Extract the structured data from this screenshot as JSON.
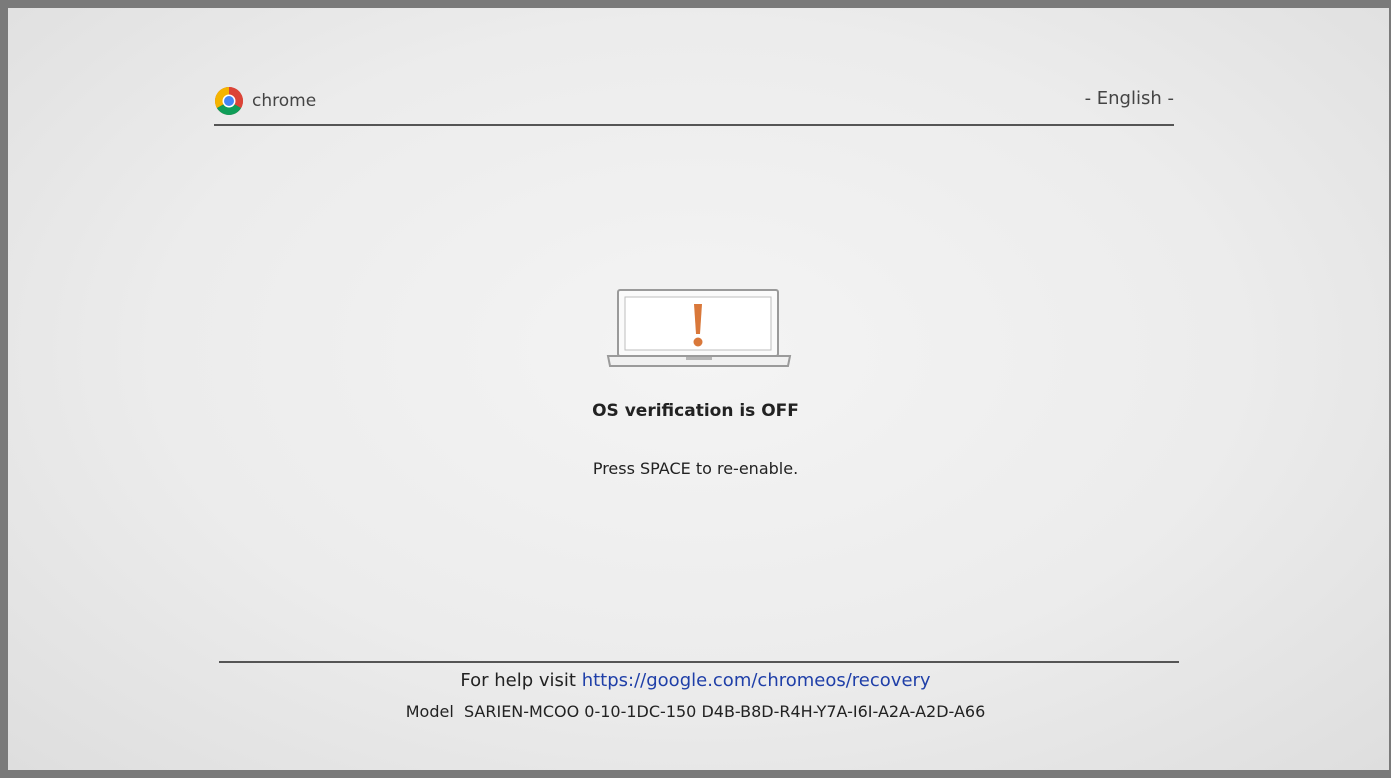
{
  "header": {
    "logo_text": "chrome",
    "logo_icon": "chrome-logo-icon",
    "language": "- English -"
  },
  "main": {
    "illustration_icon": "laptop-warning-icon",
    "title": "OS verification is OFF",
    "instruction": "Press SPACE to re-enable."
  },
  "footer": {
    "help_prefix": "For help visit",
    "help_url": "https://google.com/chromeos/recovery",
    "model_label": "Model",
    "model_value": "SARIEN-MCOO 0-10-1DC-150 D4B-B8D-R4H-Y7A-I6I-A2A-A2D-A66"
  },
  "colors": {
    "background": "#ececec",
    "text": "#222222",
    "link": "#1f3fa8",
    "warning": "#d9783a"
  }
}
